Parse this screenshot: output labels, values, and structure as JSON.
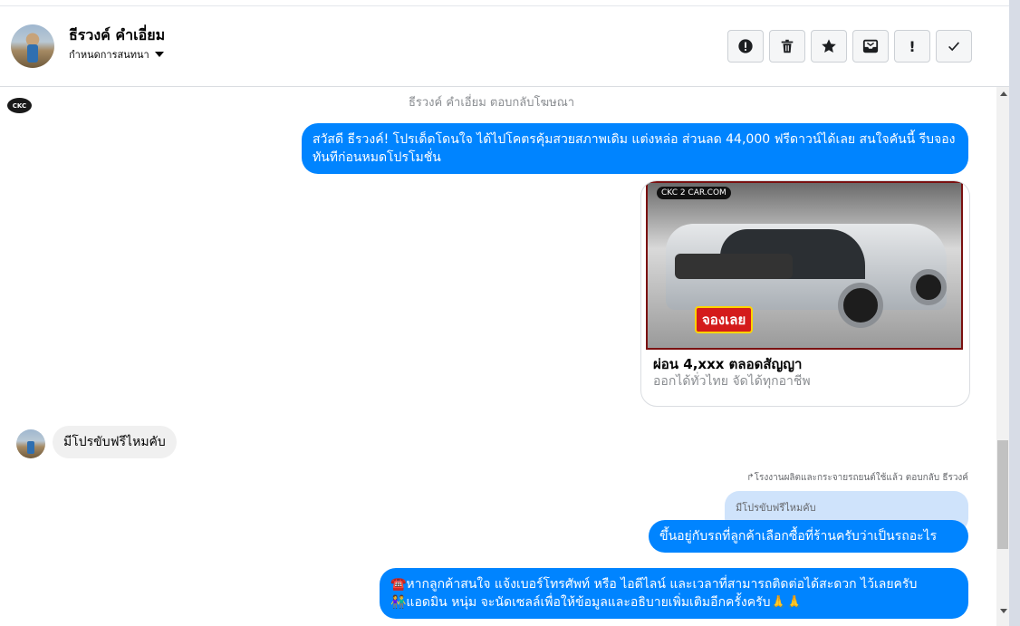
{
  "header": {
    "name": "ธีรวงค์ คำเอี่ยม",
    "subtitle": "กำหนดการสนทนา"
  },
  "actions": [
    {
      "name": "alert-button",
      "icon": "alert-circle-icon"
    },
    {
      "name": "delete-button",
      "icon": "trash-icon"
    },
    {
      "name": "star-button",
      "icon": "star-icon"
    },
    {
      "name": "archive-button",
      "icon": "inbox-icon"
    },
    {
      "name": "important-button",
      "icon": "exclamation-icon",
      "label": "!"
    },
    {
      "name": "done-button",
      "icon": "check-icon"
    }
  ],
  "chat": {
    "page_logo_text": "CKC",
    "ad_reply_note": "ธีรวงค์ คำเอี่ยม ตอบกลับโฆษณา",
    "promo_message": "สวัสดี ธีรวงค์! โปรเด็ดโดนใจ ได้ไปโคตรคุ้มสวยสภาพเดิม แต่งหล่อ  ส่วนลด 44,000 ฟรีดาวน์ได้เลย  สนใจคันนี้ รีบจองทันทีก่อนหมดโปรโมชั่น",
    "card": {
      "brand": "CKC 2 CAR.COM",
      "badge": "จองเลย",
      "title": "ผ่อน 4,xxx ตลอดสัญญา",
      "subtitle": "ออกได้ทั่วไทย จัดได้ทุกอาชีพ"
    },
    "customer_message": "มีโปรขับฟรีไหมคับ",
    "reply_meta": "↱โรงงานผลิตและกระจายรถยนต์ใช้แล้ว ตอบกลับ ธีรวงค์",
    "quoted_message": "มีโปรขับฟรีไหมคับ",
    "reply_message": "ขึ้นอยู่กับรถที่ลูกค้าเลือกซื้อที่ร้านครับว่าเป็นรถอะไร",
    "followup_line1": "☎️หากลูกค้าสนใจ แจ้งเบอร์โทรศัพท์ หรือ ไอดีไลน์ และเวลาที่สามารถติดต่อได้สะดวก ไว้เลยครับ",
    "followup_line2": "👫แอดมิน หนุ่ม จะนัดเซลล์เพื่อให้ข้อมูลและอธิบายเพิ่มเติมอีกครั้งครับ🙏🙏"
  },
  "colors": {
    "accent": "#0084ff",
    "incoming_bubble": "#f0f0f0",
    "quote_bubble": "#cfe3fb"
  }
}
